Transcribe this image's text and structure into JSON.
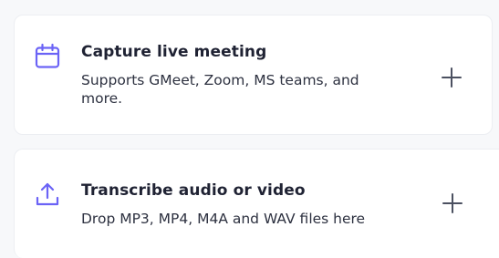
{
  "accent_color": "#6b63f6",
  "cards": [
    {
      "icon": "calendar-icon",
      "title": "Capture live meeting",
      "subtitle": "Supports GMeet, Zoom, MS teams, and more.",
      "action_icon": "plus-icon"
    },
    {
      "icon": "upload-icon",
      "title": "Transcribe audio or video",
      "subtitle": "Drop MP3, MP4, M4A and WAV files here",
      "action_icon": "plus-icon"
    }
  ]
}
